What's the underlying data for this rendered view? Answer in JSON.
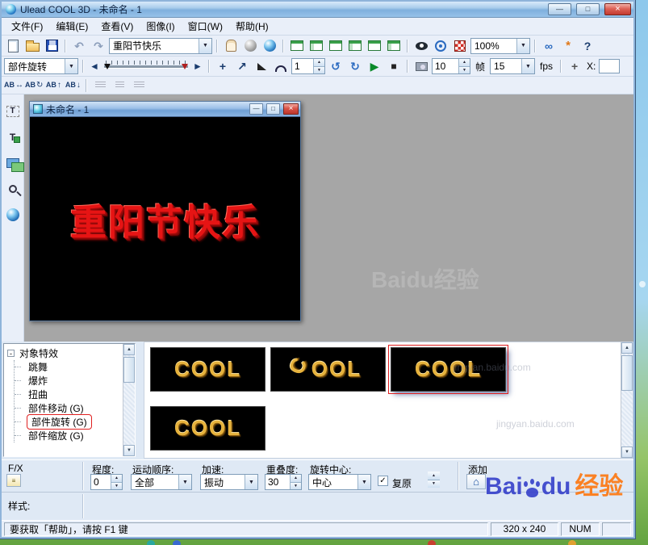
{
  "window": {
    "title": "Ulead COOL 3D - 未命名 - 1"
  },
  "menubar": {
    "items": [
      {
        "label": "文件(F)"
      },
      {
        "label": "编辑(E)"
      },
      {
        "label": "查看(V)"
      },
      {
        "label": "图像(I)"
      },
      {
        "label": "窗口(W)"
      },
      {
        "label": "帮助(H)"
      }
    ]
  },
  "toolbar_main": {
    "text_style_combo": "重阳节快乐",
    "zoom_combo": "100%"
  },
  "toolbar_anim": {
    "effect_combo": "部件旋转",
    "current_frame": "1",
    "total_frames": "10",
    "frame_unit": "帧",
    "fps_value": "15",
    "fps_unit": "fps",
    "x_label": "X:"
  },
  "child_window": {
    "title": "未命名 - 1",
    "canvas_text": "重阳节快乐"
  },
  "effects_tree": {
    "root": "对象特效",
    "items": [
      {
        "label": "跳舞"
      },
      {
        "label": "爆炸"
      },
      {
        "label": "扭曲"
      },
      {
        "label": "部件移动 (G)"
      },
      {
        "label": "部件旋转 (G)"
      },
      {
        "label": "部件缩放 (G)"
      }
    ]
  },
  "gallery": {
    "items": [
      {
        "label": "COOL"
      },
      {
        "first": "C",
        "rest": "OOL"
      },
      {
        "label": "COOL"
      },
      {
        "label": "COOL"
      }
    ]
  },
  "params": {
    "fx_label": "F/X",
    "degree_label": "程度:",
    "degree_value": "0",
    "order_label": "运动顺序:",
    "order_value": "全部",
    "accel_label": "加速:",
    "accel_value": "振动",
    "overlap_label": "重叠度:",
    "overlap_value": "30",
    "center_label": "旋转中心:",
    "center_value": "中心",
    "restore_label": "复原",
    "add_label": "添加",
    "style_label": "样式:"
  },
  "statusbar": {
    "help_text": "要获取「帮助」，请按 F1 键",
    "canvas_size": "320 x 240",
    "num_label": "NUM"
  },
  "watermark": {
    "brand_bai": "Bai",
    "brand_du": "du",
    "brand_jingyan": "经验",
    "brand_full": "Baidu经验",
    "site": "jingyan.baidu.com"
  },
  "icons": {
    "minimize_glyph": "—",
    "maximize_glyph": "□",
    "close_glyph": "×",
    "dropdown_glyph": "▼",
    "up_glyph": "▲",
    "down_glyph": "▼",
    "left_glyph": "◄",
    "right_glyph": "►",
    "undo_glyph": "↶",
    "redo_glyph": "↷",
    "rotate_ccw_glyph": "↺",
    "rotate_cw_glyph": "↻",
    "play_glyph": "▶",
    "stop_glyph": "■",
    "check_glyph": "✓",
    "home_glyph": "⌂",
    "help_glyph": "?",
    "link_glyph": "∞",
    "star_glyph": "*",
    "plus_glyph": "+",
    "arrow_ne_glyph": "↗",
    "arrow_h_glyph": "↔",
    "arrow_up_glyph": "↑",
    "arrow_down_glyph": "↓",
    "ab_glyph": "AB",
    "collapse_glyph": "-",
    "t_glyph": "T"
  }
}
